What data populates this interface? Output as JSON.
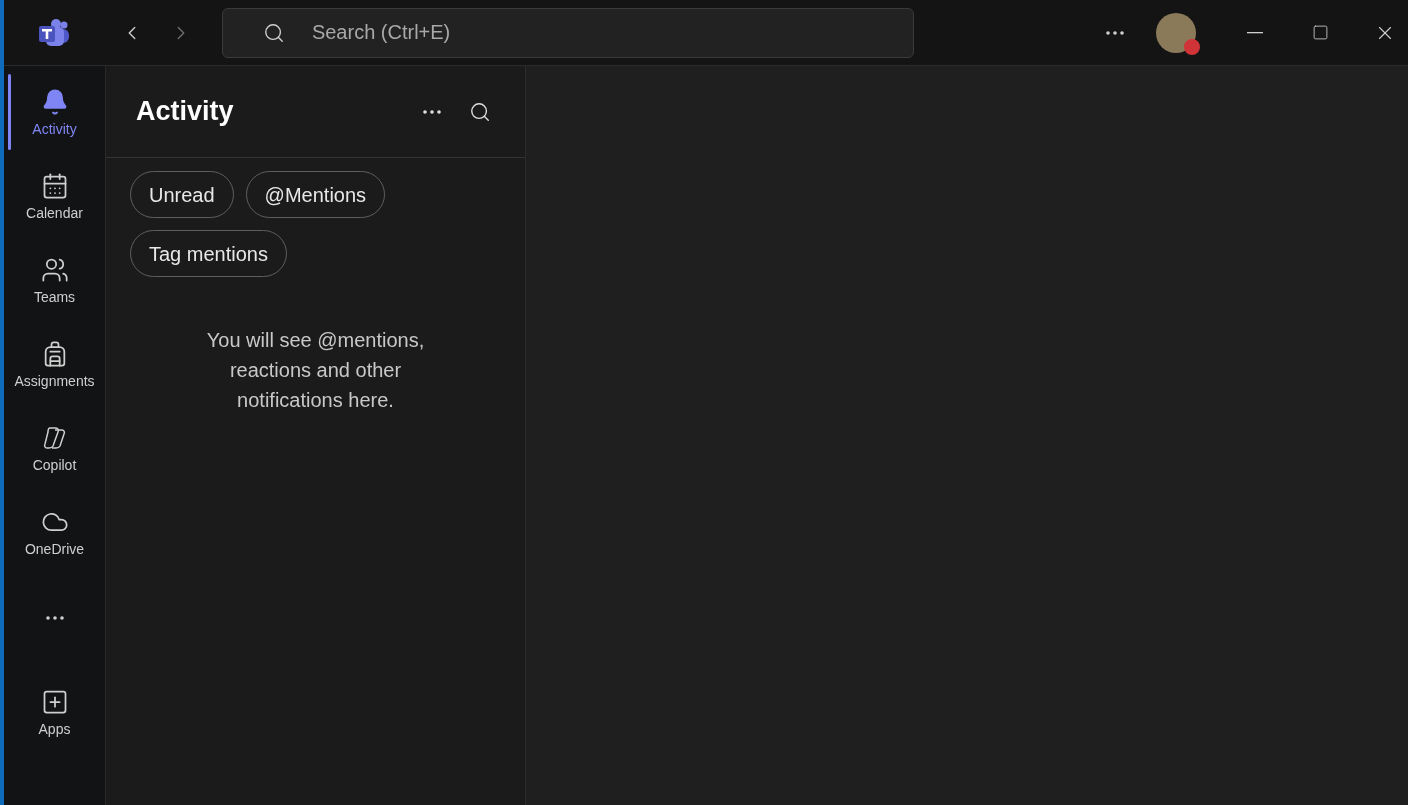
{
  "title_bar": {
    "search": {
      "placeholder": "Search (Ctrl+E)"
    },
    "status_dot": {
      "color": "#d13438"
    }
  },
  "rail": [
    {
      "kind": "bell",
      "label": "Activity",
      "selected": true
    },
    {
      "kind": "calendar",
      "label": "Calendar",
      "selected": false
    },
    {
      "kind": "teams",
      "label": "Teams",
      "selected": false
    },
    {
      "kind": "backpack",
      "label": "Assignments",
      "selected": false
    },
    {
      "kind": "copilot",
      "label": "Copilot",
      "selected": false
    },
    {
      "kind": "cloud",
      "label": "OneDrive",
      "selected": false
    },
    {
      "kind": "more",
      "selected": false
    },
    {
      "kind": "add",
      "label": "Apps",
      "selected": false
    }
  ],
  "panel": {
    "title": "Activity",
    "filters": [
      {
        "label": "Unread",
        "selected": false
      },
      {
        "label": "@Mentions",
        "selected": false
      },
      {
        "label": "Tag mentions",
        "selected": false
      }
    ],
    "empty_message": "You will see @mentions, reactions and other notifications here."
  }
}
